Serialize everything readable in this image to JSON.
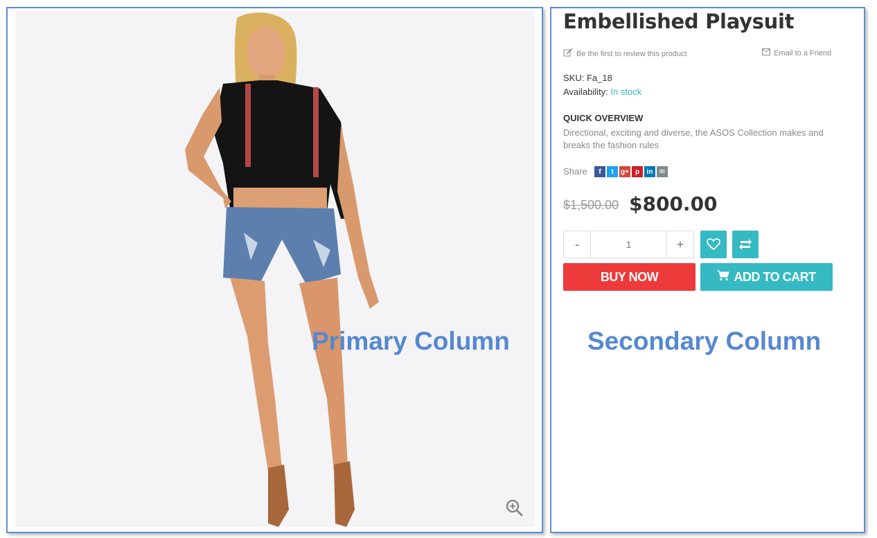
{
  "product": {
    "title": "Embellished Playsuit",
    "review_link": "Be the first to review this product",
    "email_link": "Email to a Friend",
    "sku_label": "SKU:",
    "sku_value": "Fa_18",
    "availability_label": "Availability:",
    "availability_value": "In stock",
    "overview_title": "QUICK OVERVIEW",
    "overview_text": "Directional, exciting and diverse, the ASOS Collection makes and breaks the fashion rules",
    "share_label": "Share",
    "share_icons": [
      {
        "name": "facebook-icon",
        "glyph": "f",
        "color": "#3b5998"
      },
      {
        "name": "twitter-icon",
        "glyph": "t",
        "color": "#1da1f2"
      },
      {
        "name": "google-plus-icon",
        "glyph": "g+",
        "color": "#d34836"
      },
      {
        "name": "pinterest-icon",
        "glyph": "p",
        "color": "#cb2027"
      },
      {
        "name": "linkedin-icon",
        "glyph": "in",
        "color": "#0077b5"
      },
      {
        "name": "email-share-icon",
        "glyph": "✉",
        "color": "#7f8c8d"
      }
    ],
    "old_price": "$1,500.00",
    "new_price": "$800.00",
    "qty_minus": "-",
    "qty_value": "1",
    "qty_plus": "+",
    "buy_now": "BUY NOW",
    "add_to_cart": "ADD TO CART"
  },
  "labels": {
    "primary_column": "Primary Column",
    "secondary_column": "Secondary Column"
  },
  "colors": {
    "accent": "#35b9c2",
    "buy_now": "#ed3a3a",
    "frame": "#5b8fd0"
  }
}
